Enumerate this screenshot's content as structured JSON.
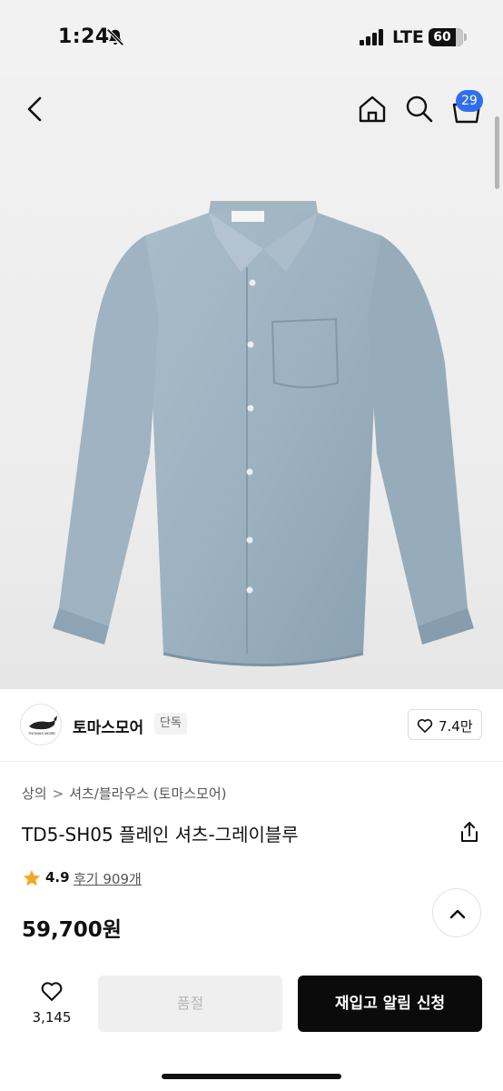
{
  "status_bar": {
    "time": "1:24",
    "network": "LTE",
    "battery": "60",
    "icons": [
      "bell-slash-icon",
      "signal-bars-icon",
      "battery-icon"
    ]
  },
  "header": {
    "icons": [
      "chevron-left-icon",
      "home-icon",
      "search-icon",
      "cart-icon"
    ],
    "cart_count": "29"
  },
  "product_image": {
    "label_text": "THOMAS MORE"
  },
  "brand": {
    "logo_text": "THOMAS MORE",
    "name": "토마스모어",
    "tag": "단독",
    "likes": "7.4만"
  },
  "breadcrumb": {
    "category": "상의",
    "separator": ">",
    "subcategory": "셔츠/블라우스 (토마스모어)"
  },
  "product": {
    "title": "TD5-SH05 플레인 셔츠-그레이블루",
    "rating": "4.9",
    "reviews": "후기 909개",
    "price": "59,700원"
  },
  "bottom_bar": {
    "wish_count": "3,145",
    "soldout_label": "품절",
    "restock_label": "재입고 알림 신청"
  },
  "colors": {
    "accent_badge": "#2f6fed",
    "star": "#f5a623",
    "primary_button": "#0b0b0b",
    "disabled_button": "#efefef"
  }
}
